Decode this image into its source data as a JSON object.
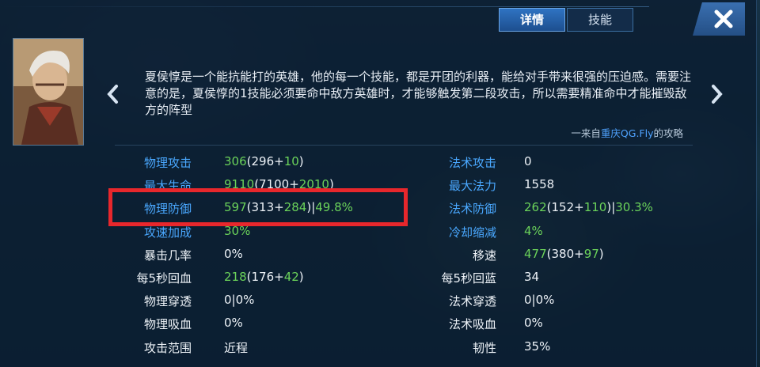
{
  "tabs": [
    {
      "label": "详情",
      "active": true
    },
    {
      "label": "技能",
      "active": false
    }
  ],
  "close_icon": "close-icon",
  "description": "夏侯惇是一个能抗能打的英雄，他的每一个技能，都是开团的利器，能给对手带来很强的压迫感。需要注意的是，夏侯惇的1技能必须要命中敌方英雄时，才能够触发第二段攻击，所以需要精准命中才能摧毁敌方的阵型",
  "credit": {
    "prefix": "一来自",
    "author": "重庆QG.Fly",
    "suffix": "的攻略"
  },
  "colors": {
    "label_blue": "#4aa8ff",
    "bonus_green": "#6bd35a",
    "highlight_red": "#e8272c",
    "tab_active": "#2f73c2"
  },
  "stats_left": [
    {
      "label": "物理攻击",
      "label_color": "blue",
      "v": [
        "306",
        "(296+",
        "10",
        ")"
      ]
    },
    {
      "label": "最大生命",
      "label_color": "blue",
      "v": [
        "9110",
        "(7100+",
        "2010",
        ")"
      ]
    },
    {
      "label": "物理防御",
      "label_color": "blue",
      "v": [
        "597",
        "(313+",
        "284",
        ")|",
        "49.8%"
      ]
    },
    {
      "label": "攻速加成",
      "label_color": "blue",
      "v": [
        "30%"
      ]
    },
    {
      "label": "暴击几率",
      "label_color": "white",
      "v": [
        "0%"
      ]
    },
    {
      "label": "每5秒回血",
      "label_color": "white",
      "v": [
        "218",
        "(176+",
        "42",
        ")"
      ]
    },
    {
      "label": "物理穿透",
      "label_color": "white",
      "v": [
        "0|0%"
      ]
    },
    {
      "label": "物理吸血",
      "label_color": "white",
      "v": [
        "0%"
      ]
    },
    {
      "label": "攻击范围",
      "label_color": "white",
      "v": [
        "近程"
      ]
    }
  ],
  "stats_right": [
    {
      "label": "法术攻击",
      "label_color": "blue",
      "v": [
        "0"
      ]
    },
    {
      "label": "最大法力",
      "label_color": "blue",
      "v": [
        "1558"
      ]
    },
    {
      "label": "法术防御",
      "label_color": "blue",
      "v": [
        "262",
        "(152+",
        "110",
        ")|",
        "30.3%"
      ]
    },
    {
      "label": "冷却缩减",
      "label_color": "blue",
      "v": [
        "4%"
      ]
    },
    {
      "label": "移速",
      "label_color": "white",
      "v": [
        "477",
        "(380+",
        "97",
        ")"
      ]
    },
    {
      "label": "每5秒回蓝",
      "label_color": "white",
      "v": [
        "34"
      ]
    },
    {
      "label": "法术穿透",
      "label_color": "white",
      "v": [
        "0|0%"
      ]
    },
    {
      "label": "法术吸血",
      "label_color": "white",
      "v": [
        "0%"
      ]
    },
    {
      "label": "韧性",
      "label_color": "white",
      "v": [
        "35%"
      ]
    }
  ]
}
